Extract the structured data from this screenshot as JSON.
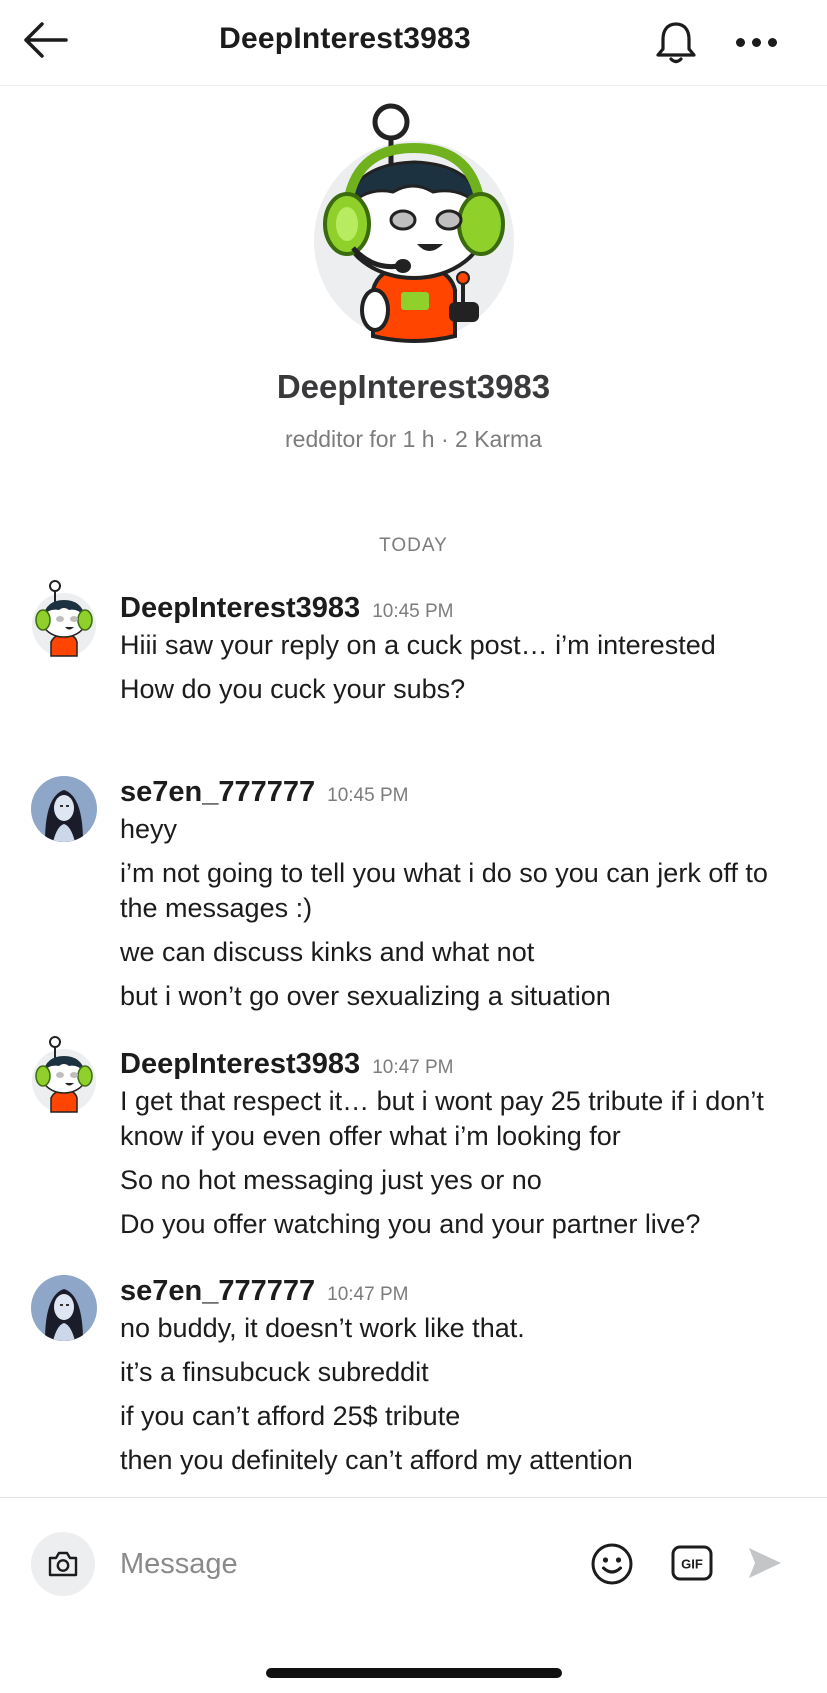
{
  "header": {
    "title": "DeepInterest3983"
  },
  "profile": {
    "name": "DeepInterest3983",
    "meta": "redditor for 1 h · 2 Karma"
  },
  "day_label": "TODAY",
  "messages": [
    {
      "author": "DeepInterest3983",
      "time": "10:45 PM",
      "lines": [
        "Hiii saw your reply on a cuck post… i’m interested",
        "How do you cuck your subs?"
      ]
    },
    {
      "author": "se7en_777777",
      "time": "10:45 PM",
      "lines": [
        "heyy",
        "i’m not going to tell you what i do so you can jerk off to the messages :)",
        "we can discuss kinks and what not",
        "but i won’t go over sexualizing a situation"
      ]
    },
    {
      "author": "DeepInterest3983",
      "time": "10:47 PM",
      "lines": [
        "I get that respect it… but i wont pay 25 tribute if i don’t know if you even offer what i’m looking for",
        "So no hot messaging just yes or no",
        "Do you offer watching you and your partner live?"
      ]
    },
    {
      "author": "se7en_777777",
      "time": "10:47 PM",
      "lines": [
        "no buddy, it doesn’t work  like that.",
        "it’s a finsubcuck subreddit",
        "if you can’t afford 25$ tribute",
        "then you definitely can’t afford my attention"
      ]
    }
  ],
  "composer": {
    "placeholder": "Message",
    "gif_label": "GIF"
  },
  "colors": {
    "primary_text": "#1c1c1c",
    "secondary_text": "#7c7c7c",
    "avatar_green": "#8fd12a",
    "avatar_orange": "#ff4500"
  },
  "icons": [
    "back-arrow-icon",
    "bell-icon",
    "more-icon",
    "camera-icon",
    "emoji-icon",
    "gif-icon",
    "send-icon"
  ]
}
